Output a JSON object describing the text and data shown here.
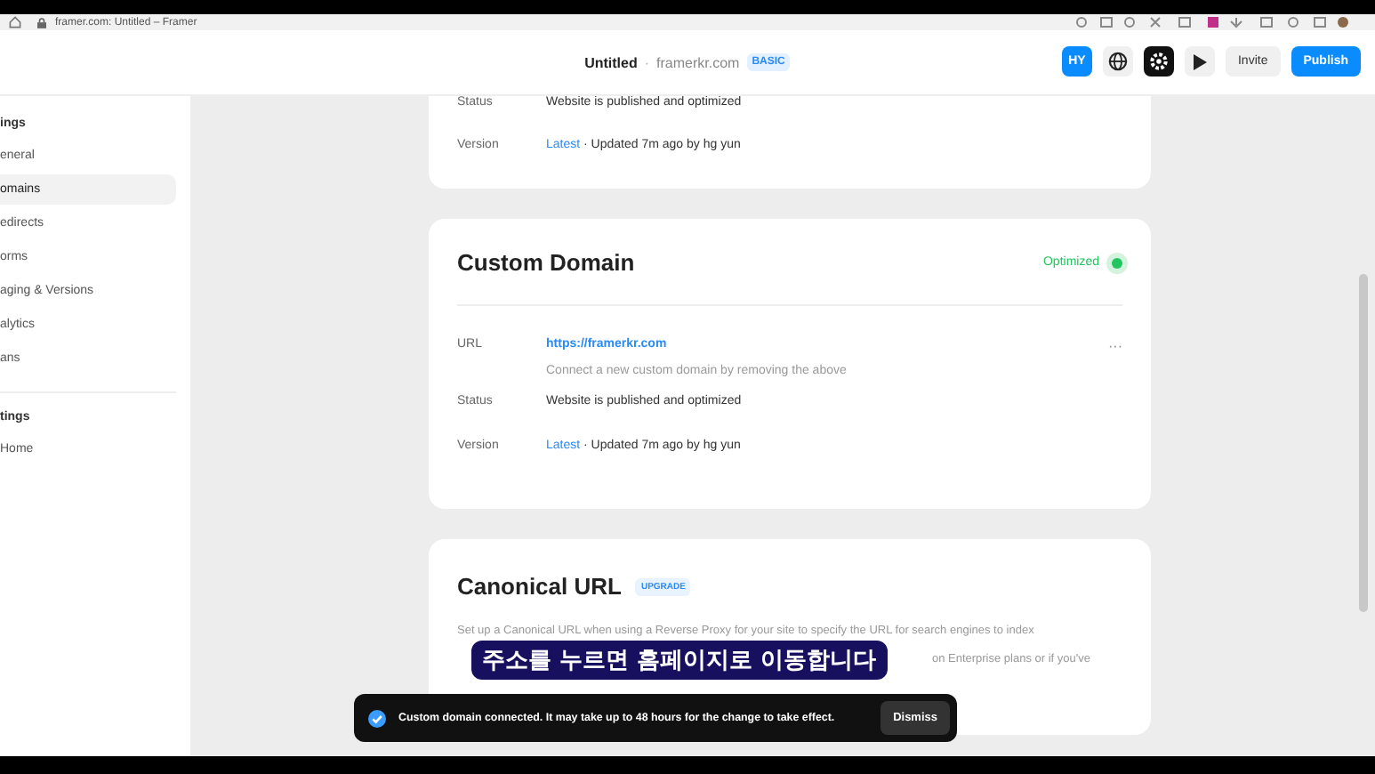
{
  "browser": {
    "address": "framer.com: Untitled – Framer"
  },
  "header": {
    "title": "Untitled",
    "separator": "·",
    "domain": "framerkr.com",
    "plan": "BASIC",
    "avatar": "HY",
    "invite": "Invite",
    "publish": "Publish"
  },
  "sidebar": {
    "groups": [
      {
        "title": "ings",
        "items": [
          {
            "label": "eneral",
            "selected": false
          },
          {
            "label": "omains",
            "selected": true
          },
          {
            "label": "edirects",
            "selected": false
          },
          {
            "label": "orms",
            "selected": false
          },
          {
            "label": "aging & Versions",
            "selected": false
          },
          {
            "label": "alytics",
            "selected": false
          },
          {
            "label": "ans",
            "selected": false
          }
        ]
      },
      {
        "title": "tings",
        "items": [
          {
            "label": "Home",
            "selected": false
          }
        ]
      }
    ]
  },
  "cards": [
    {
      "kind": "rows",
      "rows": [
        {
          "label": "Status",
          "value": "Website is published and optimized"
        },
        {
          "label": "Version",
          "link": "Latest",
          "value": " · Updated 7m ago by hg yun"
        }
      ]
    },
    {
      "kind": "domain",
      "title": "Custom Domain",
      "status": "Optimized",
      "rows": [
        {
          "label": "URL",
          "link": "https://framerkr.com",
          "hint": "Connect a new custom domain by removing the above",
          "menu": "···"
        },
        {
          "label": "Status",
          "value": "Website is published and optimized"
        },
        {
          "label": "Version",
          "link": "Latest",
          "value": " · Updated 7m ago by hg yun"
        }
      ]
    },
    {
      "kind": "canonical",
      "title": "Canonical URL",
      "badge": "UPGRADE",
      "lines": [
        "Set up a Canonical URL when using a Reverse Proxy for your site to specify the URL for search engines to index",
        "on Enterprise plans or if you've"
      ]
    }
  ],
  "caption": "주소를 누르면 홈페이지로 이동합니다",
  "toast": {
    "message": "Custom domain connected. It may take up to 48 hours for the change to take effect.",
    "action": "Dismiss"
  }
}
